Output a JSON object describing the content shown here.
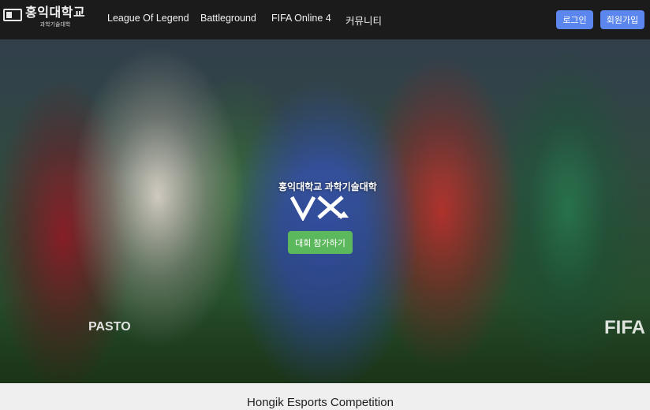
{
  "logo": {
    "main": "홍익대학교",
    "sub": "과학기술대학"
  },
  "nav": {
    "items": [
      {
        "label": "League Of Legend"
      },
      {
        "label": "Battleground"
      },
      {
        "label": "FIFA Online 4"
      },
      {
        "label": "커뮤니티"
      }
    ],
    "login_label": "로그인",
    "signup_label": "회원가입"
  },
  "hero": {
    "title": "홍익대학교 과학기술대학",
    "logo_text": "VX",
    "cta_label": "대회 참가하기",
    "ads": [
      "PASTO",
      "FIFA"
    ]
  },
  "section": {
    "title": "Hongik Esports Competition"
  },
  "colors": {
    "navbar": "#1b1b1b",
    "button_blue": "#5a86ee",
    "cta_green": "#5cb85c"
  }
}
